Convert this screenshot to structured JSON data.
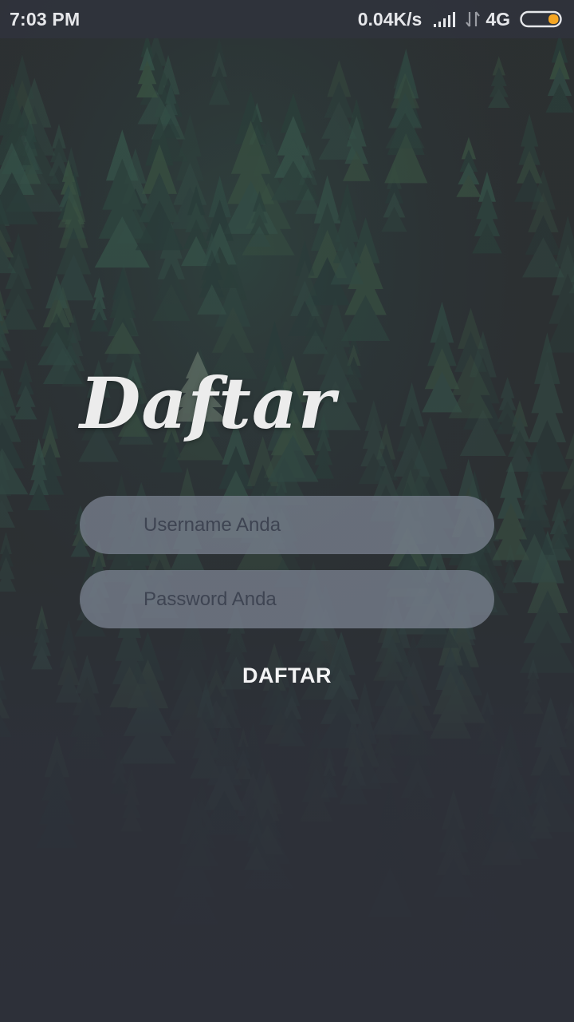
{
  "status_bar": {
    "time": "7:03 PM",
    "net_speed": "0.04K/s",
    "network_type": "4G",
    "signal_icon": "signal-bars-icon",
    "data_icon": "data-arrows-icon",
    "battery_icon": "battery-icon",
    "battery_level": 0.15,
    "battery_color": "#f5a623"
  },
  "form": {
    "title": "Daftar",
    "username": {
      "placeholder": "Username Anda",
      "value": ""
    },
    "password": {
      "placeholder": "Password Anda",
      "value": ""
    },
    "submit_label": "DAFTAR"
  },
  "theme": {
    "background": "#2d3039",
    "field_fill": "#78808e",
    "text": "#f4f4f5"
  }
}
